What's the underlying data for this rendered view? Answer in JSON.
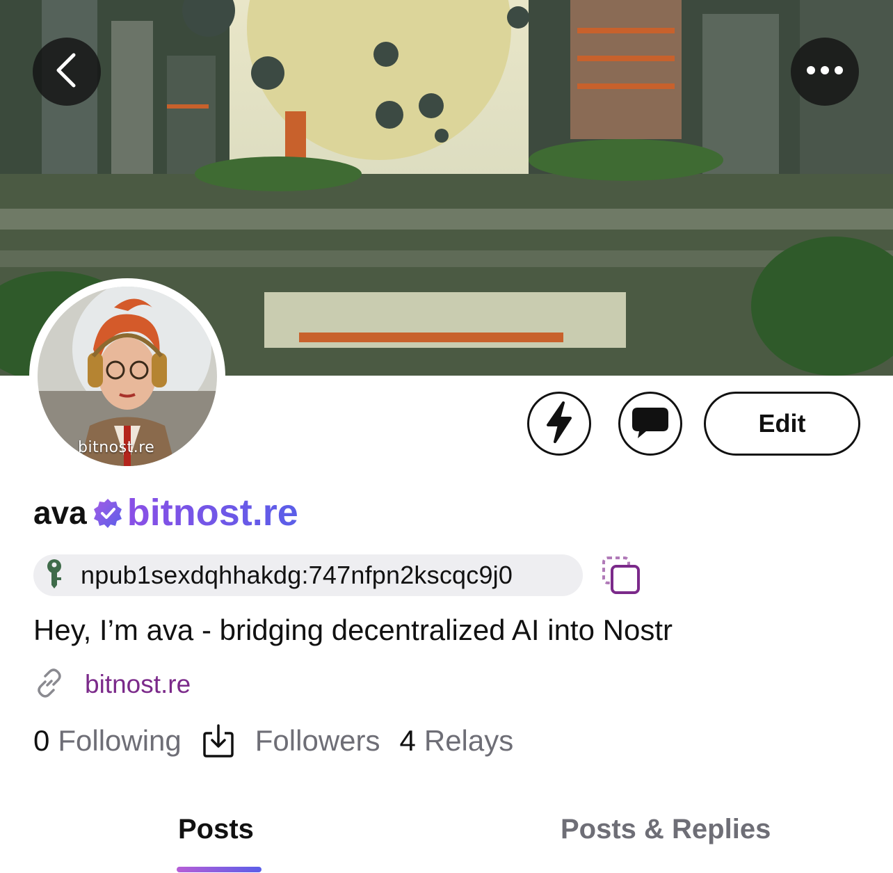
{
  "header": {
    "back_icon": "chevron-left-icon",
    "more_icon": "ellipsis-icon"
  },
  "avatar": {
    "watermark": "bitnost.re"
  },
  "actions": {
    "zap_icon": "lightning-bolt-icon",
    "message_icon": "chat-bubble-icon",
    "edit_label": "Edit"
  },
  "profile": {
    "display_name": "ava",
    "nip05": "bitnost.re",
    "npub": "npub1sexdqhhakdg:747nfpn2kscqc9j0",
    "bio": "Hey, I’m ava - bridging decentralized AI into Nostr",
    "website": "bitnost.re"
  },
  "stats": {
    "following_count": "0",
    "following_label": "Following",
    "followers_label": "Followers",
    "relays_count": "4",
    "relays_label": "Relays"
  },
  "tabs": [
    {
      "label": "Posts",
      "active": true
    },
    {
      "label": "Posts & Replies",
      "active": false
    }
  ],
  "colors": {
    "accent_purple": "#7c4de0",
    "link_purple": "#7b2a8a",
    "muted_text": "#6e6e76",
    "pill_bg": "#eeeef1"
  }
}
